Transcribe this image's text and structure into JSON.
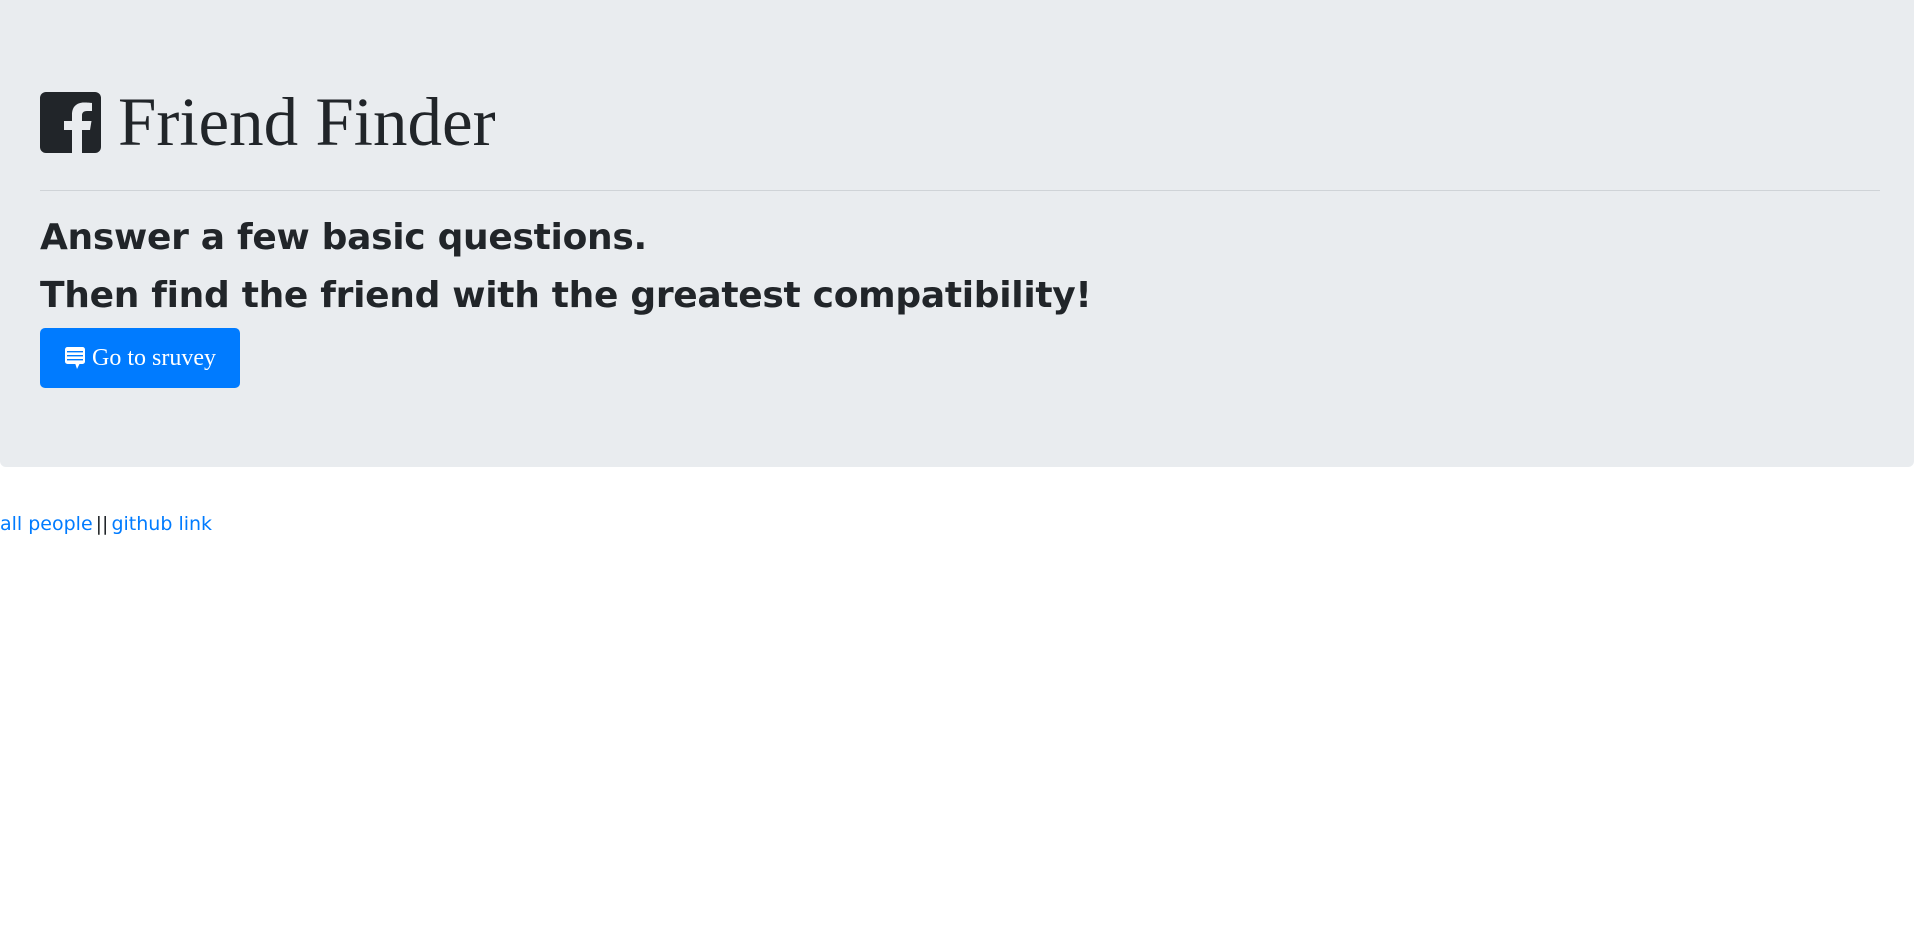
{
  "header": {
    "logo_icon": "facebook-square-icon",
    "title": "Friend Finder"
  },
  "intro": {
    "line1": "Answer a few basic questions.",
    "line2": "Then find the friend with the greatest compatibility!"
  },
  "survey_button": {
    "icon": "comment-alt-icon",
    "label": "Go to sruvey"
  },
  "footer": {
    "all_people_link": "all people",
    "separator": "||",
    "github_link": "github link"
  },
  "colors": {
    "jumbotron_bg": "#e9ecef",
    "primary": "#007bff",
    "text": "#212529"
  }
}
